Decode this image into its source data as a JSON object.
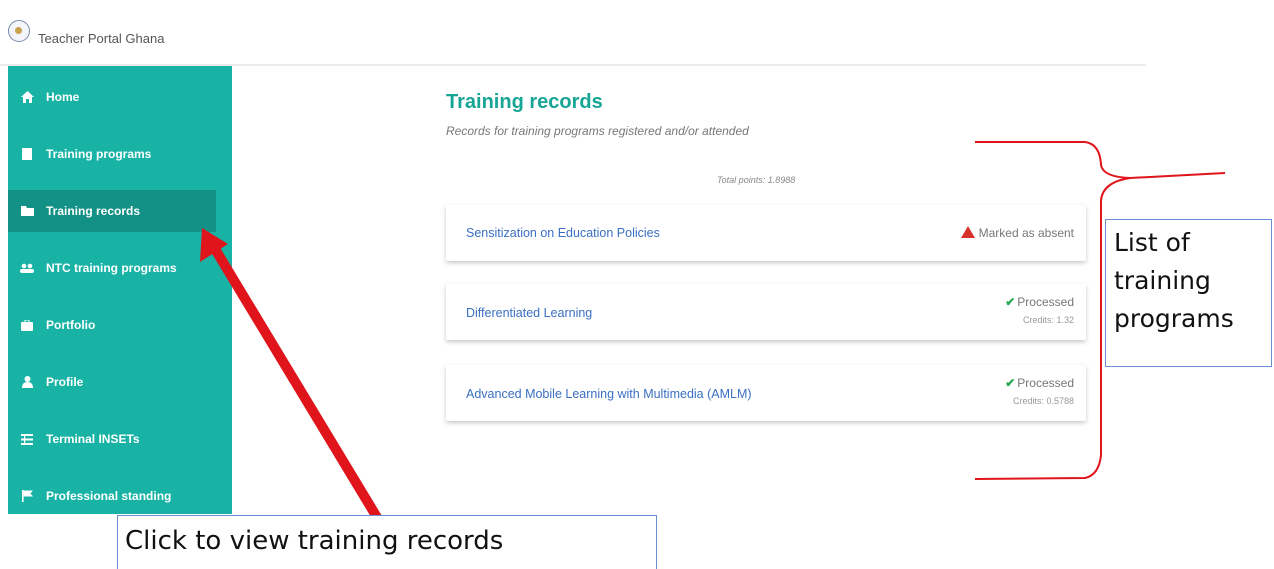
{
  "app": {
    "title": "Teacher Portal Ghana"
  },
  "sidebar": {
    "items": [
      {
        "label": "Home",
        "icon": "home-icon"
      },
      {
        "label": "Training programs",
        "icon": "file-icon"
      },
      {
        "label": "Training records",
        "icon": "folder-icon",
        "active": true
      },
      {
        "label": "NTC training programs",
        "icon": "users-icon"
      },
      {
        "label": "Portfolio",
        "icon": "briefcase-icon"
      },
      {
        "label": "Profile",
        "icon": "user-icon"
      },
      {
        "label": "Terminal INSETs",
        "icon": "list-icon"
      },
      {
        "label": "Professional standing",
        "icon": "flag-icon"
      }
    ]
  },
  "main": {
    "title": "Training records",
    "subtitle": "Records for training programs registered and/or attended",
    "total_points": "Total points: 1.8988",
    "records": [
      {
        "title": "Sensitization on Education Policies",
        "status": "Marked as absent",
        "status_icon": "warning-icon",
        "credits": ""
      },
      {
        "title": "Differentiated Learning",
        "status": "Processed",
        "status_icon": "check-icon",
        "credits": "Credits: 1.32"
      },
      {
        "title": "Advanced Mobile Learning with Multimedia (AMLM)",
        "status": "Processed",
        "status_icon": "check-icon",
        "credits": "Credits: 0.5788"
      }
    ]
  },
  "annotations": {
    "right_callout": "List of training programs",
    "right_callout_lines": [
      "List of",
      "training",
      "programs"
    ],
    "bottom_callout": "Click to view training records",
    "arrow_color": "#e0141b",
    "bracket_color": "#e0141b"
  },
  "colors": {
    "sidebar": "#19b3a6",
    "sidebar_active": "#139187",
    "title": "#17a596",
    "link": "#3a6fc2"
  }
}
